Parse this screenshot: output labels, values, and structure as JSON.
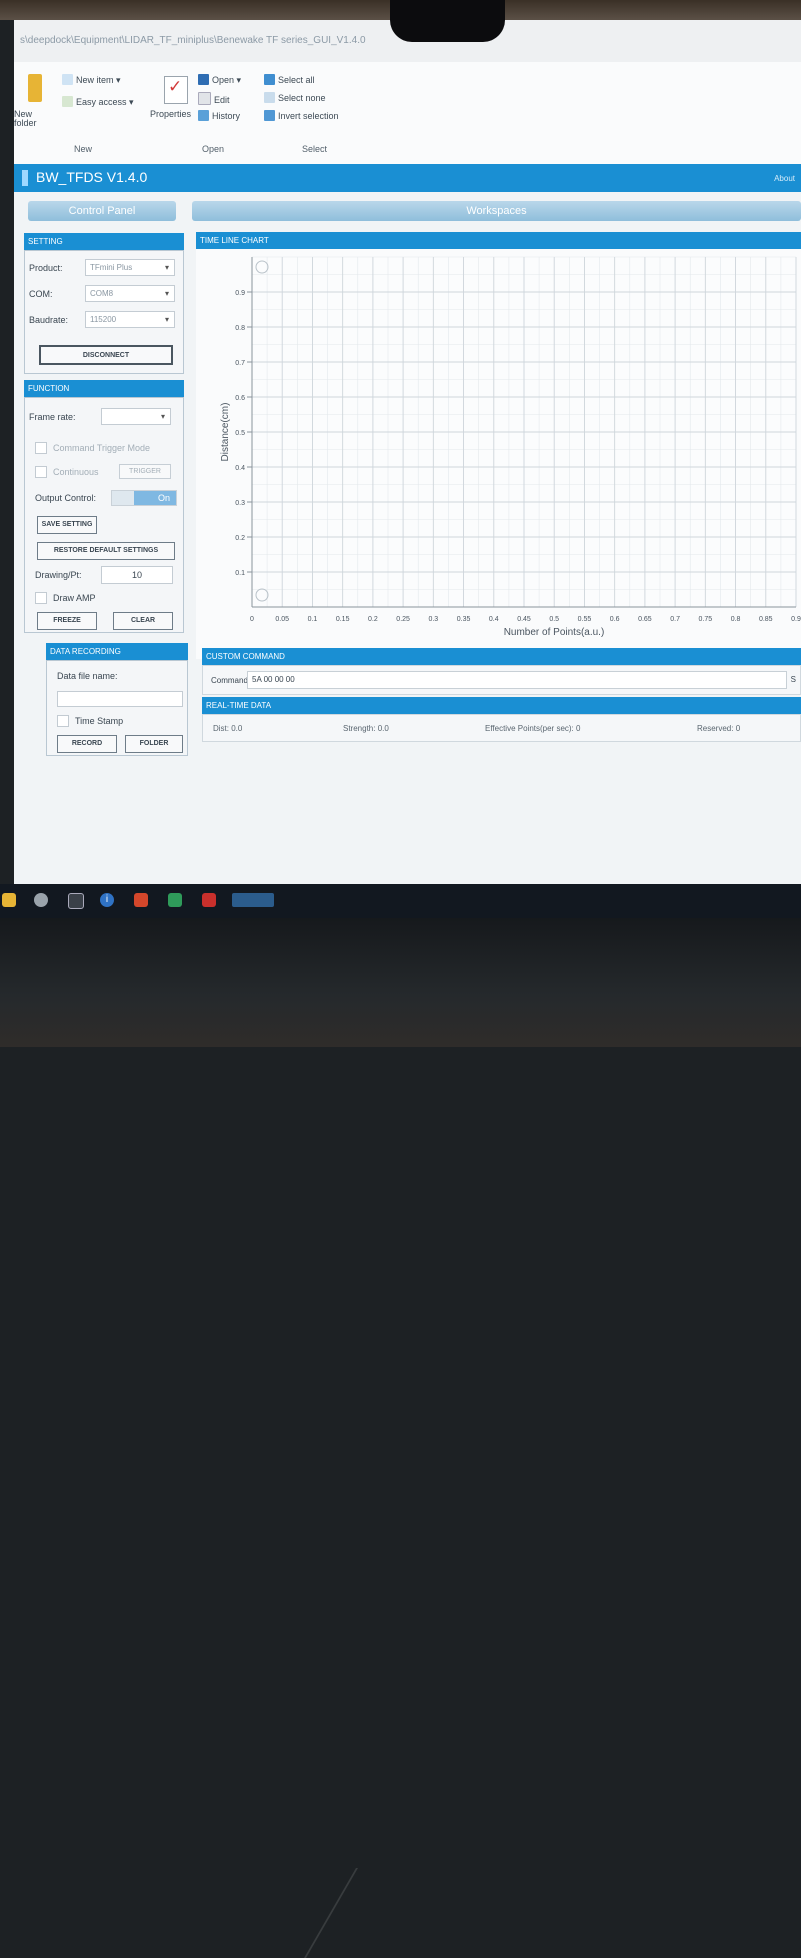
{
  "explorer": {
    "path": "s\\deepdock\\Equipment\\LIDAR_TF_miniplus\\Benewake TF series_GUI_V1.4.0",
    "ribbon": {
      "new_folder": "New\nfolder",
      "new_item": "New item ▾",
      "easy_access": "Easy access ▾",
      "properties": "Properties",
      "open": "Open ▾",
      "edit": "Edit",
      "history": "History",
      "select_all": "Select all",
      "select_none": "Select none",
      "invert_selection": "Invert selection",
      "group_new": "New",
      "group_open": "Open",
      "group_select": "Select"
    }
  },
  "app": {
    "title": "BW_TFDS V1.4.0",
    "about": "About"
  },
  "control_panel": {
    "title": "Control Panel",
    "setting": {
      "header": "SETTING",
      "product_label": "Product:",
      "product_value": "TFmini Plus",
      "com_label": "COM:",
      "com_value": "COM8",
      "baudrate_label": "Baudrate:",
      "baudrate_value": "115200",
      "disconnect": "DISCONNECT"
    },
    "function": {
      "header": "FUNCTION",
      "frame_rate_label": "Frame rate:",
      "frame_rate_value": "",
      "command_trigger_mode": "Command Trigger Mode",
      "continuous": "Continuous",
      "trigger": "TRIGGER",
      "output_control_label": "Output Control:",
      "output_control_value": "On",
      "save_setting": "SAVE SETTING",
      "restore_default": "RESTORE DEFAULT SETTINGS",
      "drawing_pt_label": "Drawing/Pt:",
      "drawing_pt_value": "10",
      "draw_amp": "Draw AMP",
      "freeze": "FREEZE",
      "clear": "CLEAR"
    },
    "data_recording": {
      "header": "DATA RECORDING",
      "file_name_label": "Data file name:",
      "file_name_value": "",
      "time_stamp": "Time Stamp",
      "record": "RECORD",
      "folder": "FOLDER"
    }
  },
  "workspace": {
    "title": "Workspaces",
    "chart_header": "TIME LINE CHART",
    "custom_command_header": "CUSTOM COMMAND",
    "command_label": "Command:",
    "command_value": "5A 00 00 00",
    "send": "S",
    "realtime_header": "REAL-TIME DATA",
    "dist_label": "Dist:",
    "dist_value": "0.0",
    "strength_label": "Strength:",
    "strength_value": "0.0",
    "effective_label": "Effective Points(per sec):",
    "effective_value": "0",
    "reserved_label": "Reserved:",
    "reserved_value": "0"
  },
  "chart_data": {
    "type": "line",
    "xlabel": "Number of Points(a.u.)",
    "ylabel": "Distance(cm)",
    "x_ticks": [
      "0",
      "0.05",
      "0.1",
      "0.15",
      "0.2",
      "0.25",
      "0.3",
      "0.35",
      "0.4",
      "0.45",
      "0.5",
      "0.55",
      "0.6",
      "0.65",
      "0.7",
      "0.75",
      "0.8",
      "0.85",
      "0.9"
    ],
    "y_ticks": [
      "0.1",
      "0.2",
      "0.3",
      "0.4",
      "0.5",
      "0.6",
      "0.7",
      "0.8",
      "0.9"
    ],
    "xlim": [
      0,
      0.9
    ],
    "ylim": [
      0,
      1
    ],
    "series": [],
    "grid": true,
    "colors": {
      "grid": "#cfd6dc",
      "axis": "#8a949c",
      "text": "#4a5560"
    }
  },
  "taskbar": {
    "icons": [
      "file-explorer-icon",
      "chrome-icon",
      "terminal-icon",
      "info-icon",
      "brave-icon",
      "app-icon",
      "acrobat-icon",
      "active-app-icon"
    ]
  }
}
